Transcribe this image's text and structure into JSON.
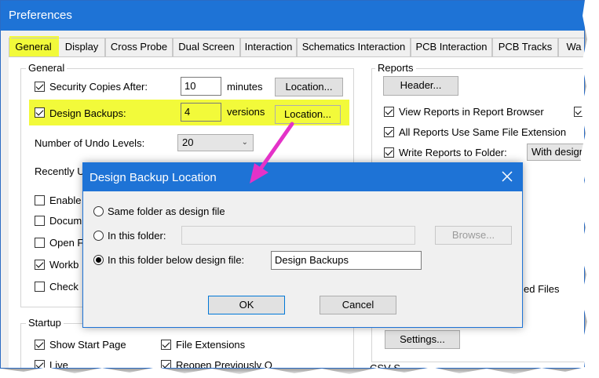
{
  "window": {
    "title": "Preferences"
  },
  "tabs": [
    "General",
    "Display",
    "Cross Probe",
    "Dual Screen",
    "Interaction",
    "Schematics Interaction",
    "PCB Interaction",
    "PCB Tracks",
    "Wa"
  ],
  "general": {
    "group_label": "General",
    "security_copies": {
      "label": "Security Copies After:",
      "value": "10",
      "unit": "minutes",
      "button": "Location..."
    },
    "design_backups": {
      "label": "Design Backups:",
      "value": "4",
      "unit": "versions",
      "button": "Location..."
    },
    "undo_levels": {
      "label": "Number of Undo Levels:",
      "value": "20"
    },
    "recently_used": "Recently U",
    "partial": [
      "Enable",
      "Docum",
      "Open F",
      "Workb",
      "Check"
    ]
  },
  "reports": {
    "group_label": "Reports",
    "header_button": "Header...",
    "view_in_browser": "View Reports in Report Browser",
    "partial_right": "A",
    "same_extension": "All Reports Use Same File Extension",
    "write_to_folder": "Write Reports to Folder:",
    "folder_select": "With design",
    "ed_files": "ed Files",
    "settings_button": "Settings...",
    "csv_partial": "CSV S"
  },
  "startup": {
    "group_label": "Startup",
    "show_start_page": "Show Start Page",
    "file_extensions": "File Extensions",
    "live_partial": "Live",
    "reopen_partial": "Reopen Previously O"
  },
  "dialog": {
    "title": "Design Backup Location",
    "option_same_folder": "Same folder as design file",
    "option_this_folder": "In this folder:",
    "this_folder_value": "",
    "browse_button": "Browse...",
    "option_below_design": "In this folder below design file:",
    "below_design_value": "Design Backups",
    "ok_button": "OK",
    "cancel_button": "Cancel"
  },
  "colors": {
    "highlight": "#f2fa3a",
    "annotation_arrow": "#e432c8",
    "title_bar": "#1e73d6"
  }
}
